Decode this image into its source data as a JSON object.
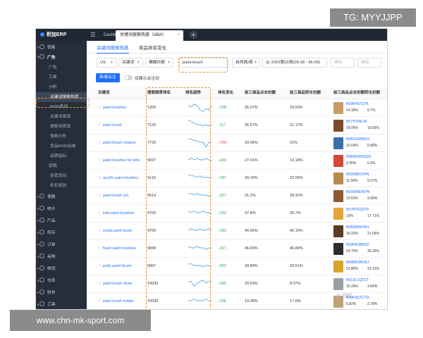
{
  "watermark_top": "TG: MYYJJPP",
  "watermark_bottom": "www.chn-mk-sport.com",
  "watermark_corner": "必 图知",
  "app": {
    "logo_text": "积加ERP"
  },
  "tabs": [
    {
      "label": "Dashboard"
    },
    {
      "label": "关键词搜索热度（ABA）"
    }
  ],
  "sidebar": [
    {
      "label": "销售",
      "kind": "top"
    },
    {
      "label": "广告",
      "kind": "top-open"
    },
    {
      "label": "广告",
      "kind": "sub"
    },
    {
      "label": "工具",
      "kind": "sub"
    },
    {
      "label": "分析",
      "kind": "sub"
    },
    {
      "label": "关键词搜索热度...",
      "kind": "active"
    },
    {
      "label": "ASIN表现",
      "kind": "sub2"
    },
    {
      "label": "关键词表现",
      "kind": "sub2"
    },
    {
      "label": "搜索词表现",
      "kind": "sub2"
    },
    {
      "label": "搜索分析",
      "kind": "sub2"
    },
    {
      "label": "竞品ASIN出单",
      "kind": "sub2"
    },
    {
      "label": "品牌指标",
      "kind": "sub2"
    },
    {
      "label": "促销",
      "kind": "sub"
    },
    {
      "label": "促销活动",
      "kind": "sub2"
    },
    {
      "label": "折扣规则",
      "kind": "sub2"
    },
    {
      "label": "客服",
      "kind": "top"
    },
    {
      "label": "统计",
      "kind": "top"
    },
    {
      "label": "产品",
      "kind": "top"
    },
    {
      "label": "库存",
      "kind": "top"
    },
    {
      "label": "订单",
      "kind": "top"
    },
    {
      "label": "采购",
      "kind": "top"
    },
    {
      "label": "物流",
      "kind": "top"
    },
    {
      "label": "仓库",
      "kind": "top"
    },
    {
      "label": "财务",
      "kind": "top"
    },
    {
      "label": "工具",
      "kind": "top"
    }
  ],
  "subtabs": [
    {
      "label": "关键词搜索热度"
    },
    {
      "label": "商品排名变化"
    }
  ],
  "filters": {
    "marketplace": "US",
    "match_type": "关键词",
    "match_mode": "模糊匹配",
    "keyword": "paint brush",
    "period": "自然周/周",
    "date_range": "2023第22周(05-28 - 06-03)",
    "rank_from_placeholder": "排名",
    "rank_to_placeholder": "排名"
  },
  "actions": {
    "add_follow": "新增关注",
    "only_followed": "仅展示关注词"
  },
  "columns": [
    "关键词",
    "搜索频率排名",
    "排名趋势",
    "排名变化",
    "前三商品点击份额",
    "前三商品转化份额",
    "前三商品点击份额转化份额"
  ],
  "rows": [
    {
      "keyword": "paint brushes",
      "rank": "1359",
      "change": "108",
      "dir": "down",
      "click": "35.07%",
      "conv": "29.59%",
      "asin": "B09HH97QTK",
      "s1": "14.39%",
      "s2": "9.7%",
      "trend": [
        6,
        5,
        7,
        6,
        3,
        2,
        4,
        3,
        6
      ],
      "thumb": "#c89d6a"
    },
    {
      "keyword": "paint brush",
      "rank": "7133",
      "change": "117",
      "dir": "down",
      "click": "36.57%",
      "conv": "31.17%",
      "asin": "B07YH26L4F",
      "s1": "18.06%",
      "s2": "16.82%",
      "trend": [
        8,
        7,
        6,
        5,
        5,
        4,
        5,
        4,
        5
      ],
      "thumb": "#7a4d2c"
    },
    {
      "keyword": "paint brush cleaner",
      "rank": "7726",
      "change": "769",
      "dir": "up",
      "click": "33.06%",
      "conv": "21%",
      "asin": "B0B1G6RMXX",
      "s1": "12.64%",
      "s2": "5.88%",
      "trend": [
        7,
        7,
        6,
        6,
        5,
        5,
        2,
        5,
        5
      ],
      "thumb": "#3a6ea5"
    },
    {
      "keyword": "paint brushes for kids",
      "rank": "9037",
      "change": "420",
      "dir": "down",
      "click": "27.01%",
      "conv": "13.18%",
      "asin": "B0BRHM3QQG",
      "s1": "9.35%",
      "s2": "0.2%",
      "trend": [
        5,
        6,
        5,
        6,
        5,
        5,
        6,
        5,
        4
      ],
      "thumb": "#d4473b"
    },
    {
      "keyword": "acrylic paint brushes",
      "rank": "9110",
      "change": "287",
      "dir": "down",
      "click": "29.16%",
      "conv": "22.55%",
      "asin": "B09SMKJXPN",
      "s1": "11.56%",
      "s2": "9.27%",
      "trend": [
        7,
        6,
        6,
        5,
        6,
        5,
        5,
        5,
        5
      ],
      "thumb": "#b88a4e"
    },
    {
      "keyword": "paint brush set",
      "rank": "9514",
      "change": "257",
      "dir": "down",
      "click": "31.2%",
      "conv": "28.32%",
      "asin": "B09SMMJKPN",
      "s1": "14.53%",
      "s2": "9.68%",
      "trend": [
        6,
        6,
        5,
        6,
        5,
        5,
        5,
        4,
        5
      ],
      "thumb": "#8e5a34"
    },
    {
      "keyword": "kids paint brushes",
      "rank": "9705",
      "change": "292",
      "dir": "down",
      "click": "37.8%",
      "conv": "26.7%",
      "asin": "B07PPGQZ78",
      "s1": "19%",
      "s2": "17.71%",
      "trend": [
        6,
        5,
        6,
        5,
        5,
        6,
        5,
        5,
        4
      ],
      "thumb": "#e6a33a"
    },
    {
      "keyword": "small paint brush",
      "rank": "9769",
      "change": "183",
      "dir": "down",
      "click": "40.06%",
      "conv": "40.19%",
      "asin": "B0BDRKRHKL",
      "s1": "20.22%",
      "s2": "21.55%",
      "trend": [
        5,
        6,
        5,
        5,
        6,
        5,
        5,
        6,
        5
      ],
      "thumb": "#5a3b26"
    },
    {
      "keyword": "foam paint brushes",
      "rank": "9849",
      "change": "317",
      "dir": "down",
      "click": "46.83%",
      "conv": "46.84%",
      "asin": "B09HR2BBXD",
      "s1": "24.79%",
      "s2": "30.26%",
      "trend": [
        6,
        5,
        5,
        6,
        5,
        5,
        4,
        5,
        5
      ],
      "thumb": "#2d2d2d"
    },
    {
      "keyword": "putty paint brush",
      "rank": "9967",
      "change": "252",
      "dir": "down",
      "click": "39.89%",
      "conv": "29.51%",
      "asin": "B08M5XMXKJ",
      "s1": "23.85%",
      "s2": "22.13%",
      "trend": [
        6,
        6,
        5,
        5,
        5,
        4,
        5,
        5,
        4
      ],
      "thumb": "#d6a52e"
    },
    {
      "keyword": "paint brush mixer",
      "rank": "10033",
      "change": "245",
      "dir": "down",
      "click": "29.53%",
      "conv": "8.07%",
      "asin": "B0C3L1QDCT",
      "s1": "10.29%",
      "s2": "4.84%",
      "trend": [
        6,
        6,
        3,
        5,
        6,
        7,
        5,
        6,
        6
      ],
      "thumb": "#9aa0a6"
    },
    {
      "keyword": "paint brush holder",
      "rank": "10039",
      "change": "206",
      "dir": "down",
      "click": "19.38%",
      "conv": "17.6%",
      "asin": "B08K4QTCTQ",
      "s1": "6.82%",
      "s2": "2.78%",
      "trend": [
        5,
        5,
        6,
        5,
        5,
        5,
        6,
        5,
        5
      ],
      "thumb": "#c0a07a"
    }
  ],
  "colors": {
    "accent": "#1e6fff",
    "highlight": "#f08a24",
    "down": "#2da44e",
    "up": "#e5483b",
    "sidebar": "#262e3b",
    "topbar": "#1f2733"
  }
}
